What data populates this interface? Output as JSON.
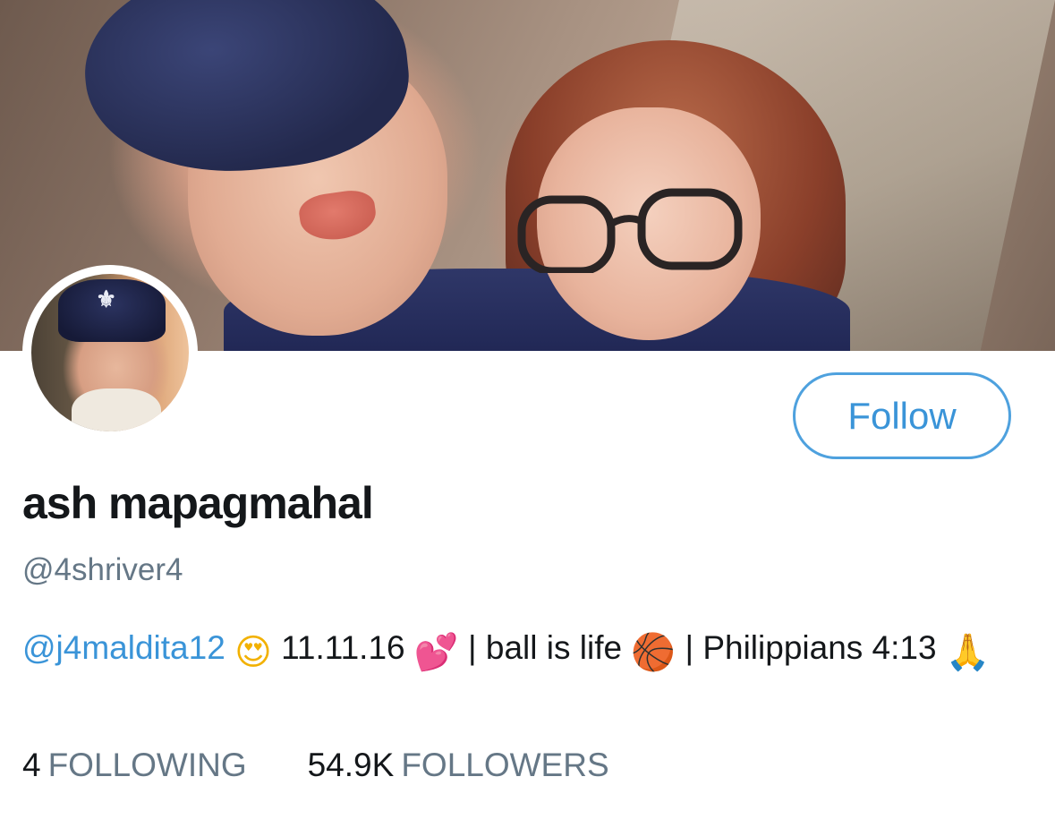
{
  "profile": {
    "display_name": "ash mapagmahal",
    "handle": "@4shriver4",
    "follow_label": "Follow",
    "bio": {
      "mention": "@j4maldita12",
      "date": "11.11.16",
      "part_ball": "| ball is life",
      "part_verse": "| Philippians 4:13",
      "emoji_heart_eyes": "😍",
      "emoji_hearts": "💕",
      "emoji_basketball": "🏀",
      "emoji_pray": "🙏"
    },
    "stats": {
      "following_count": "4",
      "following_label": "FOLLOWING",
      "followers_count": "54.9K",
      "followers_label": "FOLLOWERS"
    }
  },
  "colors": {
    "accent": "#3a94d8",
    "text_primary": "#14171a",
    "text_secondary": "#657786"
  }
}
